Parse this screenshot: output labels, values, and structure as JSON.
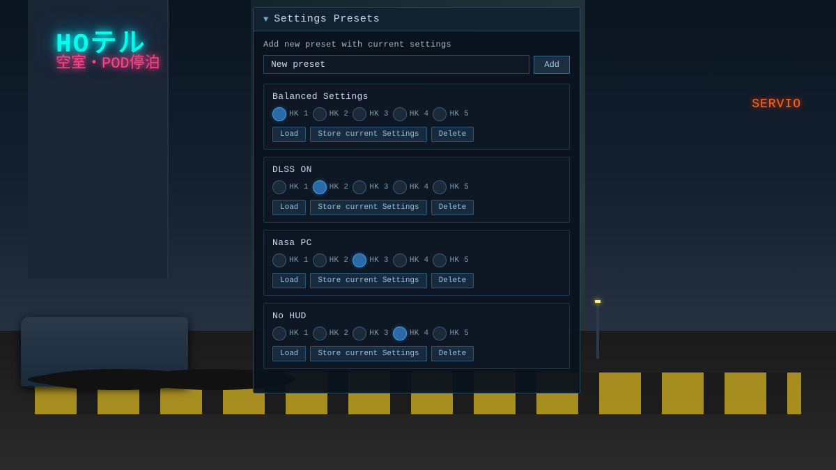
{
  "panel": {
    "title": "Settings Presets",
    "add_section": {
      "label": "Add new preset with current settings",
      "input_value": "New preset",
      "input_placeholder": "New preset",
      "add_button": "Add"
    },
    "presets": [
      {
        "id": "balanced",
        "name": "Balanced Settings",
        "hotkeys": [
          {
            "id": "hk1",
            "label": "HK 1",
            "active": true
          },
          {
            "id": "hk2",
            "label": "HK 2",
            "active": false
          },
          {
            "id": "hk3",
            "label": "HK 3",
            "active": false
          },
          {
            "id": "hk4",
            "label": "HK 4",
            "active": false
          },
          {
            "id": "hk5",
            "label": "HK 5",
            "active": false
          }
        ],
        "load_label": "Load",
        "store_label": "Store current Settings",
        "delete_label": "Delete"
      },
      {
        "id": "dlss",
        "name": "DLSS ON",
        "hotkeys": [
          {
            "id": "hk1",
            "label": "HK 1",
            "active": false
          },
          {
            "id": "hk2",
            "label": "HK 2",
            "active": true
          },
          {
            "id": "hk3",
            "label": "HK 3",
            "active": false
          },
          {
            "id": "hk4",
            "label": "HK 4",
            "active": false
          },
          {
            "id": "hk5",
            "label": "HK 5",
            "active": false
          }
        ],
        "load_label": "Load",
        "store_label": "Store current Settings",
        "delete_label": "Delete"
      },
      {
        "id": "nasapc",
        "name": "Nasa PC",
        "hotkeys": [
          {
            "id": "hk1",
            "label": "HK 1",
            "active": false
          },
          {
            "id": "hk2",
            "label": "HK 2",
            "active": false
          },
          {
            "id": "hk3",
            "label": "HK 3",
            "active": true
          },
          {
            "id": "hk4",
            "label": "HK 4",
            "active": false
          },
          {
            "id": "hk5",
            "label": "HK 5",
            "active": false
          }
        ],
        "load_label": "Load",
        "store_label": "Store current Settings",
        "delete_label": "Delete"
      },
      {
        "id": "nohud",
        "name": "No HUD",
        "hotkeys": [
          {
            "id": "hk1",
            "label": "HK 1",
            "active": false
          },
          {
            "id": "hk2",
            "label": "HK 2",
            "active": false
          },
          {
            "id": "hk3",
            "label": "HK 3",
            "active": false
          },
          {
            "id": "hk4",
            "label": "HK 4",
            "active": true
          },
          {
            "id": "hk5",
            "label": "HK 5",
            "active": false
          }
        ],
        "load_label": "Load",
        "store_label": "Store current Settings",
        "delete_label": "Delete"
      }
    ]
  },
  "bg": {
    "hotel_sign": "HOテル",
    "hotel_sub": "空室・POD停泊",
    "right_sign": "SERVIO"
  }
}
